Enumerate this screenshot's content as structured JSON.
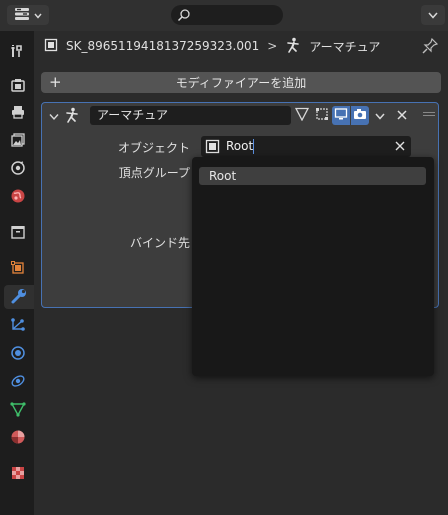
{
  "header": {
    "editor_type_icon": "properties-editor-icon",
    "search": {
      "placeholder": ""
    },
    "options_icon": "chevron-down-icon"
  },
  "tabs": [
    {
      "name": "tool",
      "icon": "wrench-screwdriver-icon",
      "color": "#d0d0d0",
      "active": false
    },
    {
      "name": "render",
      "icon": "camera-back-icon",
      "color": "#d0d0d0",
      "active": false
    },
    {
      "name": "output",
      "icon": "printer-icon",
      "color": "#d0d0d0",
      "active": false
    },
    {
      "name": "view-layer",
      "icon": "image-stack-icon",
      "color": "#d0d0d0",
      "active": false
    },
    {
      "name": "scene",
      "icon": "scene-icon",
      "color": "#d0d0d0",
      "active": false
    },
    {
      "name": "world",
      "icon": "world-icon",
      "color": "#c94545",
      "active": false
    },
    {
      "name": "collection",
      "icon": "collection-box-icon",
      "color": "#d0d0d0",
      "active": false
    },
    {
      "name": "object",
      "icon": "object-square-icon",
      "color": "#e3833a",
      "active": false
    },
    {
      "name": "modifiers",
      "icon": "wrench-icon",
      "color": "#4f8fe0",
      "active": true
    },
    {
      "name": "particles",
      "icon": "particles-icon",
      "color": "#4f8fe0",
      "active": false
    },
    {
      "name": "physics",
      "icon": "physics-icon",
      "color": "#4f8fe0",
      "active": false
    },
    {
      "name": "constraints",
      "icon": "constraints-icon",
      "color": "#4f8fe0",
      "active": false
    },
    {
      "name": "data",
      "icon": "mesh-data-icon",
      "color": "#3fbf6a",
      "active": false
    },
    {
      "name": "material",
      "icon": "material-sphere-icon",
      "color": "#d05a5a",
      "active": false
    },
    {
      "name": "texture",
      "icon": "checker-texture-icon",
      "color": "#c94545",
      "active": false
    }
  ],
  "breadcrumb": {
    "object_name": "SK_8965119418137259323.001",
    "separator": ">",
    "modifier_name": "アーマチュア"
  },
  "add_modifier_label": "モディファイアーを追加",
  "modifier": {
    "name": "アーマチュア",
    "object_label": "オブジェクト",
    "object_value": "Root",
    "vertex_group_label": "頂点グループ",
    "bind_label": "バインド先"
  },
  "dropdown": {
    "items": [
      "Root"
    ]
  },
  "colors": {
    "accent": "#4772b3",
    "panel": "#3d3d3d",
    "field": "#1e1e1e"
  }
}
